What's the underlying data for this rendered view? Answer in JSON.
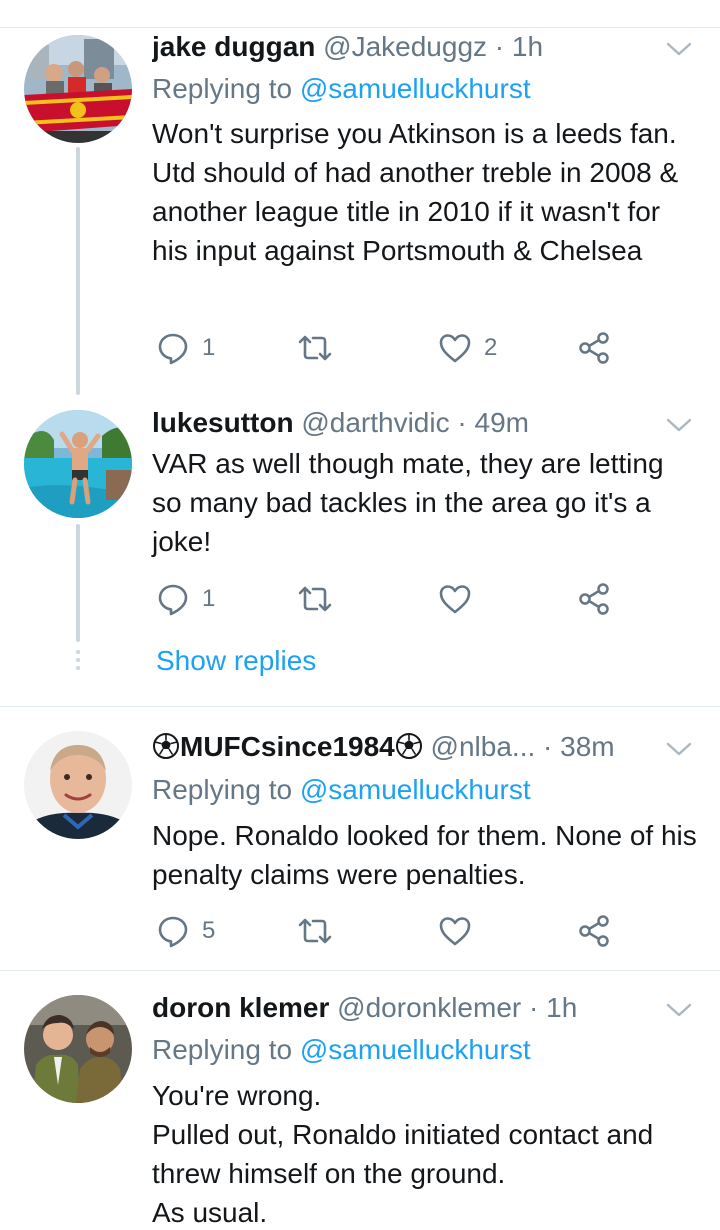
{
  "tweets": [
    {
      "name": "jake duggan",
      "handle": "@Jakeduggz",
      "time": "1h",
      "replying_label": "Replying to",
      "replying_to": "@samuelluckhurst",
      "text": "Won't surprise you Atkinson is a leeds fan. Utd should of had another treble in 2008 & another league title in 2010 if it wasn't for his input against Portsmouth & Chelsea",
      "replies": "1",
      "likes": "2"
    },
    {
      "name": "lukesutton",
      "handle": "@darthvidic",
      "time": "49m",
      "text": "VAR as well though mate, they are letting so many bad tackles in the area go it's a joke!",
      "replies": "1",
      "likes": ""
    },
    {
      "name": "MUFCsince1984",
      "handle": "@nlba...",
      "time": "38m",
      "replying_label": "Replying to",
      "replying_to": "@samuelluckhurst",
      "text": "Nope. Ronaldo looked for them. None of his penalty claims were penalties.",
      "replies": "5",
      "likes": ""
    },
    {
      "name": "doron klemer",
      "handle": "@doronklemer",
      "time": "1h",
      "replying_label": "Replying to",
      "replying_to": "@samuelluckhurst",
      "text_lines": [
        "You're wrong.",
        "Pulled out, Ronaldo initiated contact and threw himself on the ground.",
        "As usual."
      ]
    }
  ],
  "show_replies": "Show replies",
  "separator": "·",
  "icons": {
    "reply": "reply-icon",
    "retweet": "retweet-icon",
    "like": "heart-icon",
    "share": "share-icon",
    "menu": "chevron-down-icon",
    "emoji": "soccer-ball-icon"
  },
  "colors": {
    "link": "#1da1f2",
    "secondary": "#657786",
    "text": "#14171a",
    "divider": "#e1e8ed",
    "thread": "#ccd6dd"
  }
}
